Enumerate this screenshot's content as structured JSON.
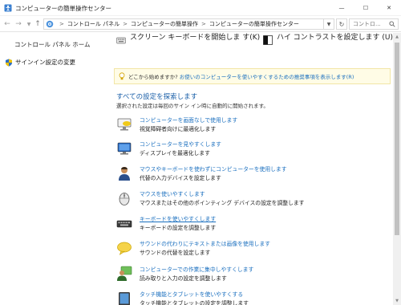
{
  "window": {
    "title": "コンピューターの簡単操作センター",
    "min_glyph": "—",
    "max_glyph": "☐",
    "close_glyph": "✕"
  },
  "address": {
    "crumbs": [
      "コントロール パネル",
      "コンピューターの簡単操作",
      "コンピューターの簡単操作センター"
    ],
    "separator": ">",
    "search_placeholder": "コントロ..."
  },
  "sidebar": {
    "home": "コントロール パネル ホーム",
    "signin": "サインイン設定の変更"
  },
  "quick_actions": [
    {
      "label": "スクリーン キーボードを開始しま す(K)",
      "icon": "onscreen-keyboard-icon"
    },
    {
      "label": "ハイ コントラストを設定します (U)",
      "icon": "high-contrast-icon"
    }
  ],
  "hint": {
    "question": "どこから始めますか?",
    "link": "お使いのコンピューターを使いやすくするための推奨事項を表示します(R)"
  },
  "explore": {
    "title": "すべての設定を探索します",
    "subtitle": "選択された設定は毎回のサイン イン時に自動的に開始されます。"
  },
  "options": [
    {
      "link": "コンピューターを画面なしで使用します",
      "desc": "視覚障碍者向けに最適化します",
      "icon": "screenless-monitor-icon"
    },
    {
      "link": "コンピューターを見やすくします",
      "desc": "ディスプレイを最適化します",
      "icon": "display-optimize-icon"
    },
    {
      "link": "マウスやキーボードを使わずにコンピューターを使用します",
      "desc": "代替の入力デバイスを設定します",
      "icon": "user-alternative-input-icon"
    },
    {
      "link": "マウスを使いやすくします",
      "desc": "マウスまたはその他のポインティング デバイスの設定を調整します",
      "icon": "mouse-icon"
    },
    {
      "link": "キーボードを使いやすくします",
      "desc": "キーボードの設定を調整します",
      "icon": "keyboard-icon"
    },
    {
      "link": "サウンドの代わりにテキストまたは画像を使用します",
      "desc": "サウンドの代替を設定します",
      "icon": "speech-bubble-icon"
    },
    {
      "link": "コンピューターでの作業に集中しやすくします",
      "desc": "読み取りと入力の設定を調整します",
      "icon": "focus-users-icon"
    },
    {
      "link": "タッチ機能とタブレットを使いやすくする",
      "desc": "タッチ機能とタブレットの設定を調整します",
      "icon": "touch-tablet-icon"
    }
  ],
  "colors": {
    "link": "#1a6fbf",
    "heading": "#1a5fa8",
    "hint_bg": "#fffce6"
  }
}
